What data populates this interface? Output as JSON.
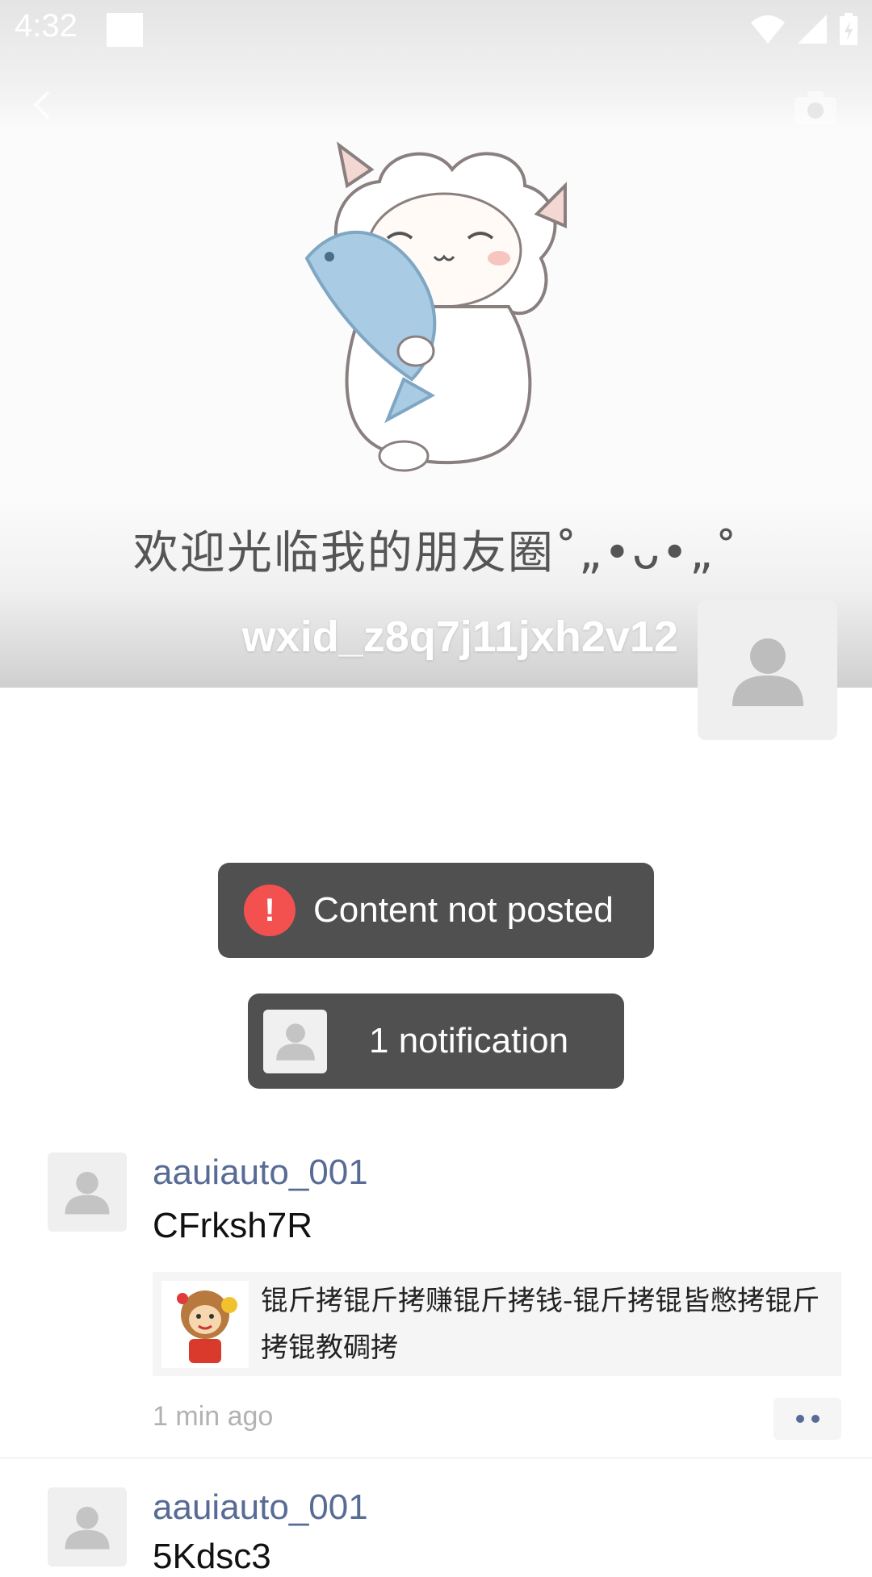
{
  "status_bar": {
    "time": "4:32"
  },
  "cover": {
    "welcome_text": "欢迎光临我的朋友圈˚„•ᴗ•„˚",
    "username": "wxid_z8q7j11jxh2v12"
  },
  "toasts": {
    "error_text": "Content not posted",
    "notification_text": "1 notification"
  },
  "feed": [
    {
      "user": "aauiauto_001",
      "text": "CFrksh7R",
      "link_title": "锟斤拷锟斤拷赚锟斤拷钱-锟斤拷锟皆憋拷锟斤拷锟教碉拷",
      "time": "1 min ago"
    },
    {
      "user": "aauiauto_001",
      "text": "5Kdsc3"
    }
  ],
  "colors": {
    "link_blue": "#576b95",
    "toast_bg": "#505050",
    "error_red": "#f35050"
  },
  "icons": [
    "back-arrow-icon",
    "camera-icon",
    "wifi-icon",
    "signal-icon",
    "battery-icon",
    "default-avatar-icon",
    "more-dots-icon"
  ]
}
